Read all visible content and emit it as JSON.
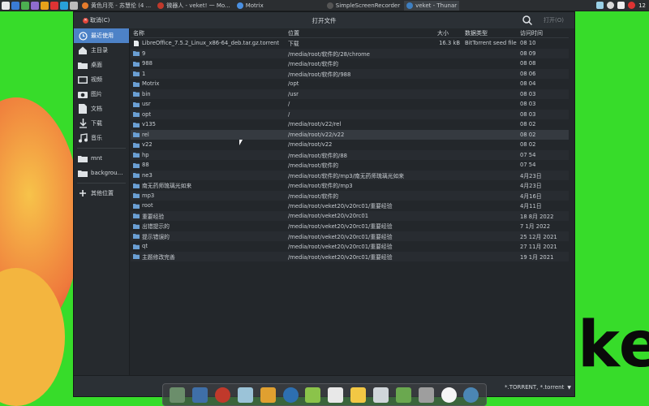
{
  "taskbar": {
    "tasks": [
      {
        "label": "黄色月亮 - 苏慧伦 (4 ..."
      },
      {
        "label": "微器人 - veket! 一 Mo..."
      },
      {
        "label": "Motrix"
      },
      {
        "label": "SimpleScreenRecorder"
      },
      {
        "label": "veket - Thunar"
      }
    ],
    "clock": "12"
  },
  "dialog": {
    "cancel_label": "取消(C)",
    "title": "打开文件",
    "open_label": "打开(O)"
  },
  "sidebar": {
    "items": [
      {
        "label": "最近使用",
        "icon": "clock-icon",
        "selected": true
      },
      {
        "label": "主目录",
        "icon": "home-icon"
      },
      {
        "label": "桌面",
        "icon": "folder-icon"
      },
      {
        "label": "视频",
        "icon": "video-icon"
      },
      {
        "label": "图片",
        "icon": "camera-icon"
      },
      {
        "label": "文档",
        "icon": "document-icon"
      },
      {
        "label": "下载",
        "icon": "download-icon"
      },
      {
        "label": "音乐",
        "icon": "music-icon"
      },
      {
        "label": "mnt",
        "icon": "folder-icon"
      },
      {
        "label": "backgrou…",
        "icon": "folder-icon"
      },
      {
        "label": "其他位置",
        "icon": "plus-icon"
      }
    ]
  },
  "columns": {
    "name": "名称",
    "location": "位置",
    "size": "大小",
    "type": "数据类型",
    "time": "访问时间"
  },
  "files": [
    {
      "name": "LibreOffice_7.5.2_Linux_x86-64_deb.tar.gz.torrent",
      "location": "下载",
      "size": "16.3 kB",
      "type": "BitTorrent seed file",
      "time": "08 10",
      "kind": "file"
    },
    {
      "name": "9",
      "location": "/media/root/软件的/28/chrome",
      "size": "",
      "type": "",
      "time": "08 09",
      "kind": "folder"
    },
    {
      "name": "988",
      "location": "/media/root/软件的",
      "size": "",
      "type": "",
      "time": "08 08",
      "kind": "folder"
    },
    {
      "name": "1",
      "location": "/media/root/软件的/988",
      "size": "",
      "type": "",
      "time": "08 06",
      "kind": "folder"
    },
    {
      "name": "Motrix",
      "location": "/opt",
      "size": "",
      "type": "",
      "time": "08 04",
      "kind": "folder"
    },
    {
      "name": "bin",
      "location": "/usr",
      "size": "",
      "type": "",
      "time": "08 03",
      "kind": "folder"
    },
    {
      "name": "usr",
      "location": "/",
      "size": "",
      "type": "",
      "time": "08 03",
      "kind": "folder"
    },
    {
      "name": "opt",
      "location": "/",
      "size": "",
      "type": "",
      "time": "08 03",
      "kind": "folder"
    },
    {
      "name": "v135",
      "location": "/media/root/v22/rel",
      "size": "",
      "type": "",
      "time": "08 02",
      "kind": "folder"
    },
    {
      "name": "rel",
      "location": "/media/root/v22/v22",
      "size": "",
      "type": "",
      "time": "08 02",
      "kind": "folder"
    },
    {
      "name": "v22",
      "location": "/media/root/v22",
      "size": "",
      "type": "",
      "time": "08 02",
      "kind": "folder"
    },
    {
      "name": "hp",
      "location": "/media/root/软件的/88",
      "size": "",
      "type": "",
      "time": "07 54",
      "kind": "folder"
    },
    {
      "name": "88",
      "location": "/media/root/软件的",
      "size": "",
      "type": "",
      "time": "07 54",
      "kind": "folder"
    },
    {
      "name": "ne3",
      "location": "/media/root/软件的/mp3/南无药师琉璃光如来",
      "size": "",
      "type": "",
      "time": "4月23日",
      "kind": "folder"
    },
    {
      "name": "南无药师琉璃光如来",
      "location": "/media/root/软件的/mp3",
      "size": "",
      "type": "",
      "time": "4月23日",
      "kind": "folder"
    },
    {
      "name": "mp3",
      "location": "/media/root/软件的",
      "size": "",
      "type": "",
      "time": "4月16日",
      "kind": "folder"
    },
    {
      "name": "root",
      "location": "/media/root/veket20/v20rc01/重要经验",
      "size": "",
      "type": "",
      "time": "4月11日",
      "kind": "folder"
    },
    {
      "name": "重要经验",
      "location": "/media/root/veket20/v20rc01",
      "size": "",
      "type": "",
      "time": "18 8月 2022",
      "kind": "folder"
    },
    {
      "name": "出错提示的",
      "location": "/media/root/veket20/v20rc01/重要经验",
      "size": "",
      "type": "",
      "time": "7 1月 2022",
      "kind": "folder"
    },
    {
      "name": "提示错误的",
      "location": "/media/root/veket20/v20rc01/重要经验",
      "size": "",
      "type": "",
      "time": "25 12月 2021",
      "kind": "folder"
    },
    {
      "name": "qt",
      "location": "/media/root/veket20/v20rc01/重要经验",
      "size": "",
      "type": "",
      "time": "27 11月 2021",
      "kind": "folder"
    },
    {
      "name": "主题修改完善",
      "location": "/media/root/veket20/v20rc01/重要经验",
      "size": "",
      "type": "",
      "time": "19 1月 2021",
      "kind": "folder"
    }
  ],
  "filter": {
    "label": "*.TORRENT, *.torrent"
  },
  "colors": {
    "accent": "#4d82c7",
    "folder": "#6a9fd4",
    "desktop": "#37dc2a"
  },
  "wallpaper_text": "ket"
}
